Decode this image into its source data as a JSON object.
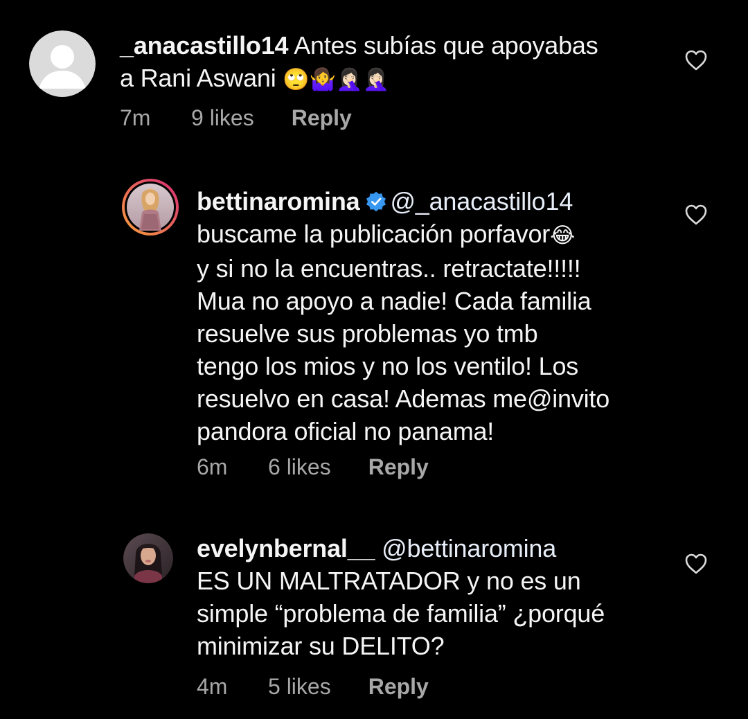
{
  "comments": [
    {
      "username": "_anacastillo14",
      "verified": false,
      "text_line1": "Antes subías que apoyabas",
      "text_line2": "a Rani Aswani",
      "emojis": "🙄🤷‍♀️🤦🏻‍♀️🤦🏻‍♀️",
      "time": "7m",
      "likes": "9 likes",
      "reply": "Reply"
    },
    {
      "username": "bettinaromina",
      "verified": true,
      "mention": "@_anacastillo14",
      "lines": [
        "buscame la publicación porfavor",
        "y si no la encuentras.. retractate!!!!!",
        "Mua no apoyo a nadie! Cada familia",
        "resuelve sus problemas yo tmb",
        "tengo los mios y no los ventilo! Los",
        "resuelvo en casa! Ademas me@invito",
        "pandora oficial no panama!"
      ],
      "emoji_after_line1": "😂",
      "time": "6m",
      "likes": "6 likes",
      "reply": "Reply"
    },
    {
      "username": "evelynbernal__",
      "verified": false,
      "mention": "@bettinaromina",
      "lines": [
        "ES UN MALTRATADOR y no es un",
        "simple “problema de familia” ¿porqué",
        "minimizar su DELITO?"
      ],
      "time": "4m",
      "likes": "5 likes",
      "reply": "Reply"
    }
  ],
  "colors": {
    "background": "#000000",
    "text": "#f5f5f5",
    "meta": "#a8a8a8",
    "verified_badge": "#3897f0",
    "story_ring_start": "#f9a23b",
    "story_ring_end": "#d62976"
  },
  "icons": {
    "like": "heart-outline-icon",
    "verified": "verified-badge-icon",
    "default_avatar": "default-avatar-icon"
  }
}
